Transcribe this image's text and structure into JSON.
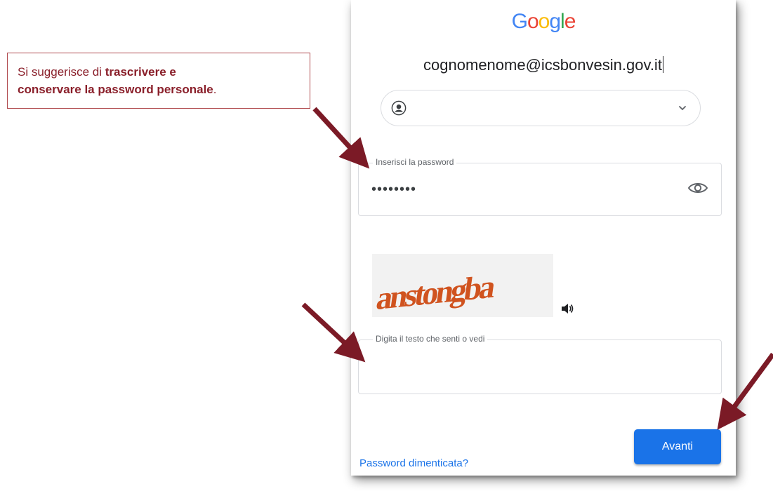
{
  "callout": {
    "line1_prefix": "Si suggerisce di ",
    "line1_bold": "trascrivere e",
    "line2_bold": "conservare la password personale",
    "line2_suffix": "."
  },
  "logo": {
    "letters": [
      "G",
      "o",
      "o",
      "g",
      "l",
      "e"
    ],
    "colors": [
      "#4285F4",
      "#EA4335",
      "#FBBC05",
      "#4285F4",
      "#34A853",
      "#EA4335"
    ]
  },
  "account": {
    "email": "cognomenome@icsbonvesin.gov.it",
    "avatar_icon": "account-circle-icon",
    "chevron_icon": "chevron-down-icon"
  },
  "password": {
    "label": "Inserisci la password",
    "value": "••••••••",
    "toggle_icon": "eye-icon"
  },
  "captcha": {
    "image_text": "anstongba",
    "audio_icon": "speaker-icon",
    "input_label": "Digita il testo che senti o vedi",
    "input_value": ""
  },
  "actions": {
    "forgot_label": "Password dimenticata?",
    "next_label": "Avanti"
  },
  "colors": {
    "accent": "#1a73e8",
    "arrow": "#7b1a26",
    "callout_text": "#8a1f2a",
    "callout_border": "#b04a4e"
  }
}
